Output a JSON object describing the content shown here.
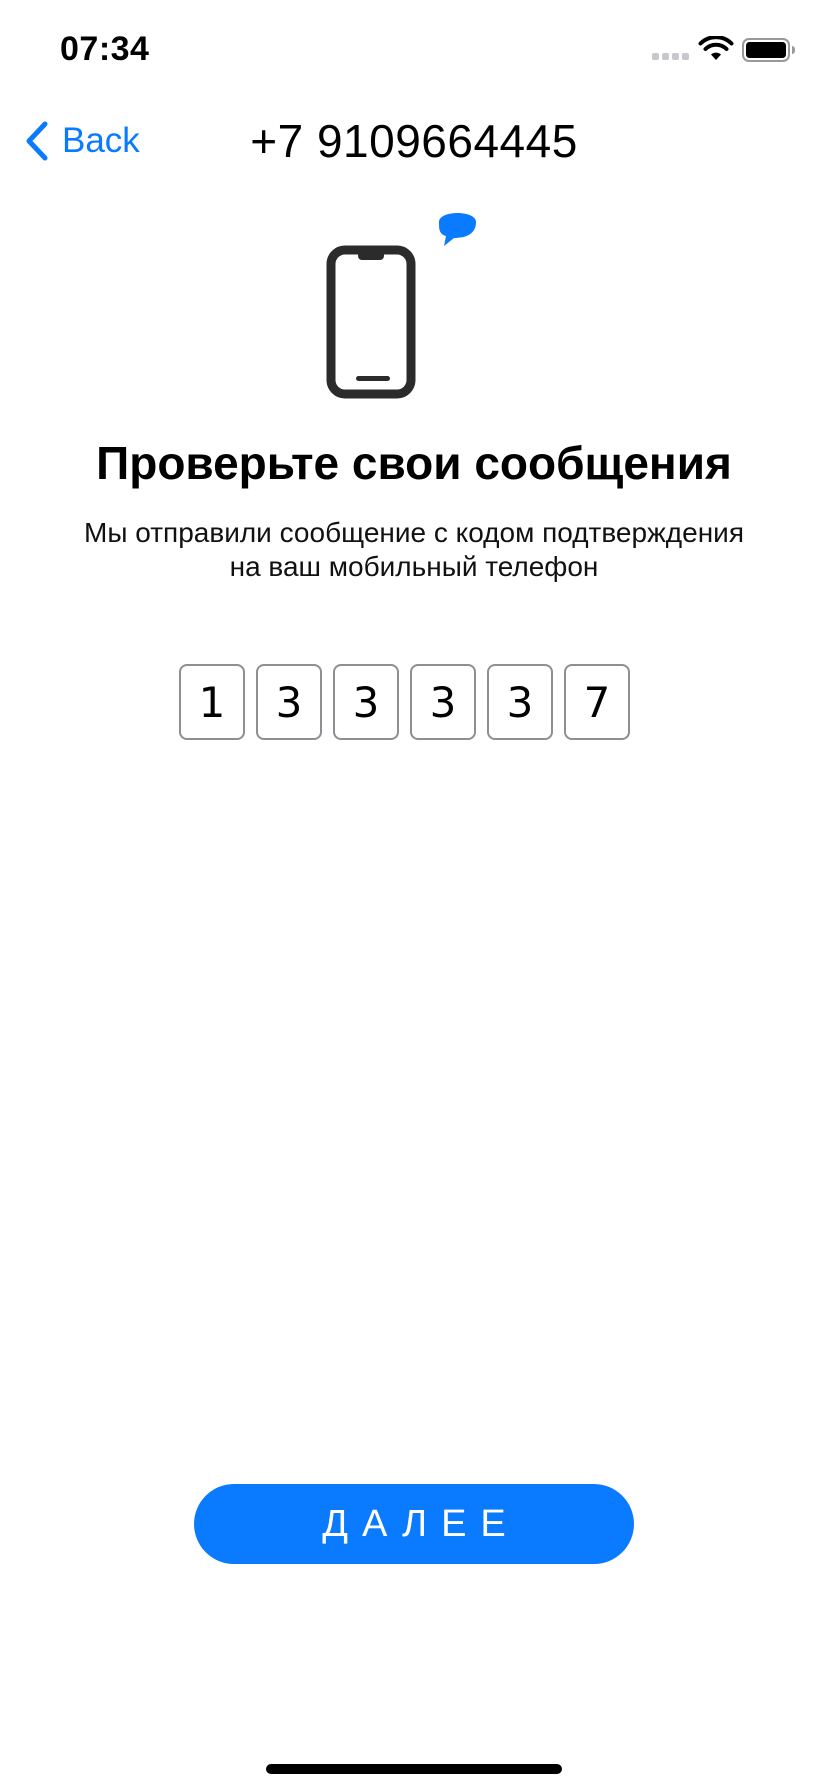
{
  "status_bar": {
    "time": "07:34"
  },
  "nav": {
    "back_label": "Back",
    "title": "+7 9109664445"
  },
  "content": {
    "heading": "Проверьте свои сообщения",
    "subtitle_line1": "Мы отправили сообщение с кодом подтверждения",
    "subtitle_line2": "на ваш мобильный телефон",
    "code_digits": [
      "1",
      "3",
      "3",
      "3",
      "3",
      "7"
    ]
  },
  "next_button": {
    "label": "ДАЛЕЕ"
  },
  "icons": {
    "back": "chevron-left-icon",
    "illustration": "phone-message-icon",
    "wifi": "wifi-icon",
    "battery": "battery-icon",
    "signal": "signal-icon"
  },
  "colors": {
    "accent": "#0A7AFF",
    "text": "#000000",
    "box_border": "#8E8E93",
    "background": "#FFFFFF"
  }
}
